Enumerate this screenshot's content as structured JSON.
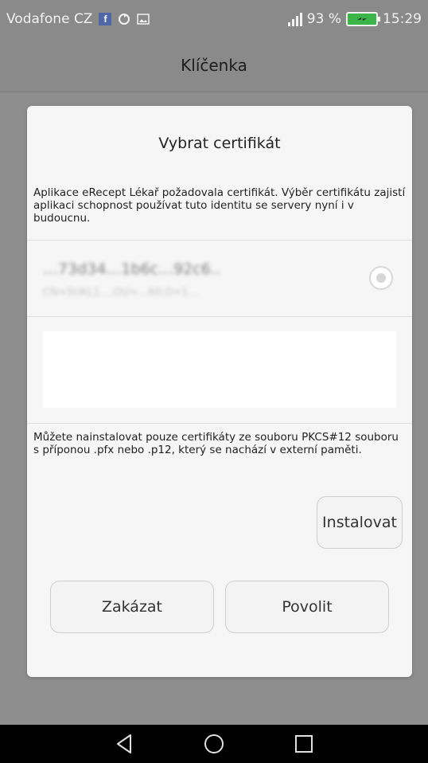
{
  "status_bar": {
    "carrier": "Vodafone CZ",
    "battery_percent": "93 %",
    "time": "15:29",
    "icons": [
      "facebook-icon",
      "sync-icon",
      "gallery-icon",
      "signal-icon",
      "battery-icon"
    ]
  },
  "app_bar": {
    "title": "Klíčenka"
  },
  "dialog": {
    "title": "Vybrat certifikát",
    "description": "Aplikace eRecept Lékař požadovala certifikát. Výběr certifikátu zajistí aplikaci schopnost používat tuto identitu se servery nyní i v budoucnu.",
    "certificate": {
      "name": "…73d34…1b6c…92c6..",
      "subject": "CN=SUKL1…,OU=…60,O=1…",
      "selected": false
    },
    "install_info": "Můžete nainstalovat pouze certifikáty ze souboru PKCS#12 souboru s příponou .pfx nebo .p12, který se nachází v externí paměti.",
    "install_label": "Instalovat",
    "deny_label": "Zakázat",
    "allow_label": "Povolit"
  },
  "nav_bar": {
    "buttons": [
      "back-icon",
      "home-icon",
      "recents-icon"
    ]
  },
  "colors": {
    "scrim": "#8e8e8e",
    "dialog_bg": "#f6f6f6",
    "battery_green": "#3bb54a",
    "facebook_blue": "#4f67a6"
  }
}
